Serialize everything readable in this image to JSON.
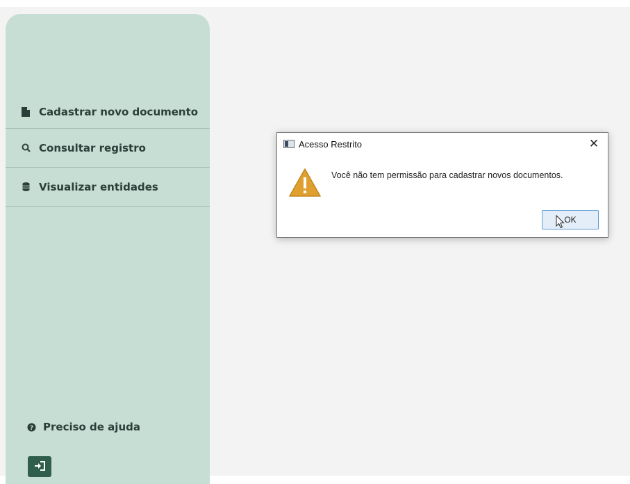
{
  "sidebar": {
    "items": [
      {
        "label": "Cadastrar novo documento",
        "icon": "file-icon"
      },
      {
        "label": "Consultar registro",
        "icon": "search-icon"
      },
      {
        "label": "Visualizar entidades",
        "icon": "database-icon"
      }
    ],
    "help_label": "Preciso de ajuda",
    "help_icon": "question-circle-icon",
    "logout_icon": "sign-out-icon"
  },
  "dialog": {
    "title": "Acesso Restrito",
    "message": "Você não tem permissão para cadastrar novos documentos.",
    "ok_label": "OK",
    "close_glyph": "✕",
    "icon": "warning-icon"
  },
  "colors": {
    "sidebar_bg": "#c6ded3",
    "content_bg": "#f3f3f3",
    "text_dark": "#2a3f39",
    "logout_btn": "#2f5f4c",
    "warning": "#e0a030"
  }
}
